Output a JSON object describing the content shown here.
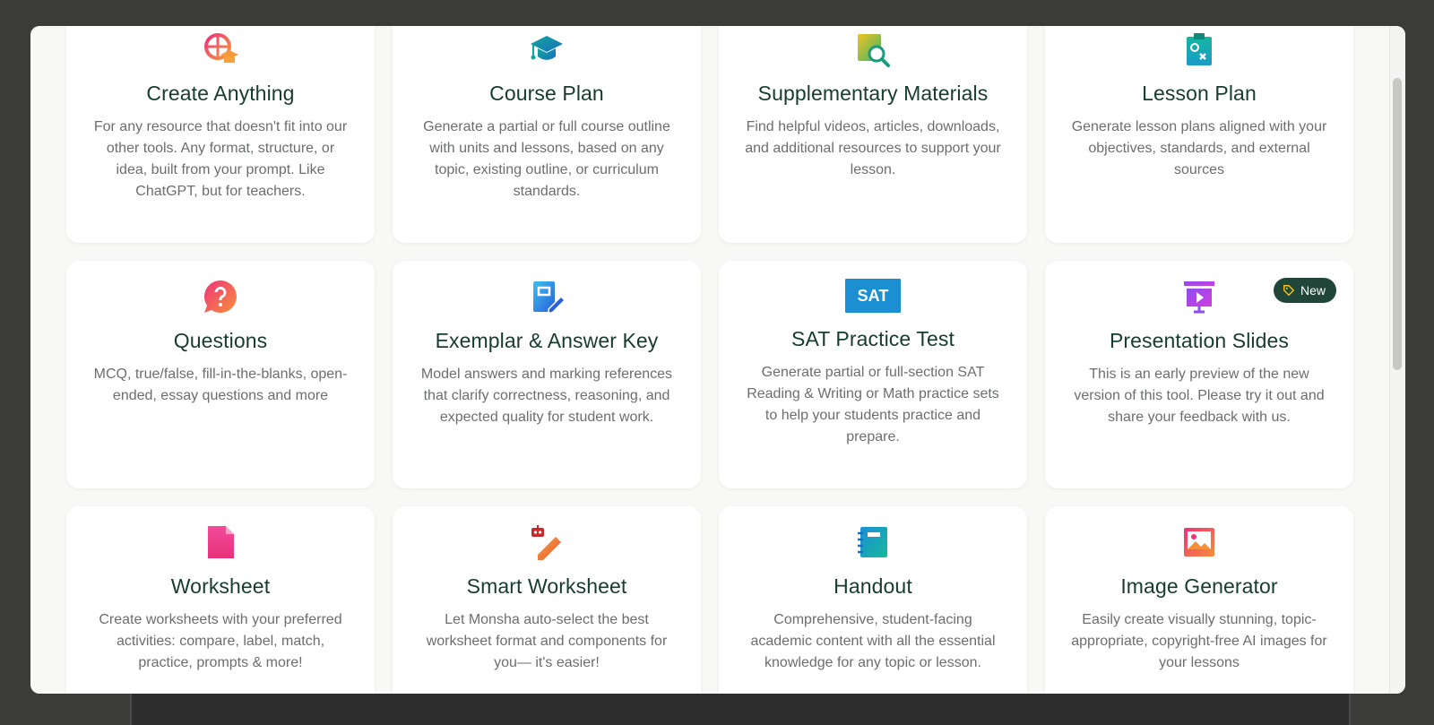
{
  "cards": [
    {
      "title": "Create Anything",
      "description": "For any resource that doesn't fit into our other tools. Any format, structure, or idea, built from your prompt. Like ChatGPT, but for teachers.",
      "icon": "globe-graduation-icon"
    },
    {
      "title": "Course Plan",
      "description": "Generate a partial or full course outline with units and lessons, based on any topic, existing outline, or curriculum standards.",
      "icon": "graduation-cap-icon"
    },
    {
      "title": "Supplementary Materials",
      "description": "Find helpful videos, articles, downloads, and additional resources to support your lesson.",
      "icon": "document-search-icon"
    },
    {
      "title": "Lesson Plan",
      "description": "Generate lesson plans aligned with your objectives, standards, and external sources",
      "icon": "clipboard-icon"
    },
    {
      "title": "Questions",
      "description": "MCQ, true/false, fill-in-the-blanks, open-ended, essay questions and more",
      "icon": "question-bubble-icon"
    },
    {
      "title": "Exemplar & Answer Key",
      "description": "Model answers and marking references that clarify correctness, reasoning, and expected quality for student work.",
      "icon": "document-pen-icon"
    },
    {
      "title": "SAT Practice Test",
      "description": "Generate partial or full-section SAT Reading & Writing or Math practice sets to help your students practice and prepare.",
      "icon": "sat-logo-icon",
      "icon_text": "SAT"
    },
    {
      "title": "Presentation Slides",
      "description": "This is an early preview of the new version of this tool. Please try it out and share your feedback with us.",
      "icon": "presentation-icon",
      "badge": "New"
    },
    {
      "title": "Worksheet",
      "description": "Create worksheets with your preferred activities: compare, label, match, practice, prompts & more!",
      "icon": "file-icon"
    },
    {
      "title": "Smart Worksheet",
      "description": "Let Monsha auto-select the best worksheet format and components for you— it's easier!",
      "icon": "robot-pencil-icon"
    },
    {
      "title": "Handout",
      "description": "Comprehensive, student-facing academic content with all the essential knowledge for any topic or lesson.",
      "icon": "notebook-icon"
    },
    {
      "title": "Image Generator",
      "description": "Easily create visually stunning, topic-appropriate, copyright-free AI images for your lessons",
      "icon": "image-icon"
    }
  ],
  "colors": {
    "title": "#173c2f",
    "badge_bg": "#1f4638",
    "sat_blue": "#1c8fd3"
  }
}
